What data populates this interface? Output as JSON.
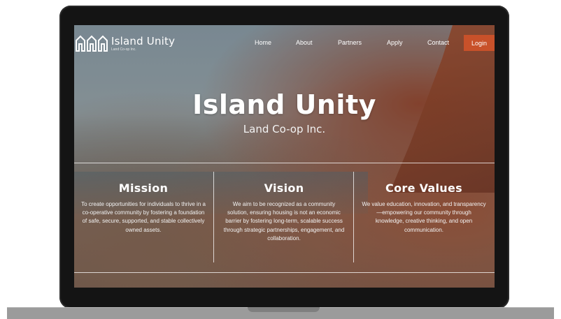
{
  "brand": {
    "name": "Island Unity",
    "subtitle": "Land Co-op Inc."
  },
  "nav": {
    "items": [
      {
        "label": "Home"
      },
      {
        "label": "About"
      },
      {
        "label": "Partners"
      },
      {
        "label": "Apply"
      },
      {
        "label": "Contact"
      }
    ],
    "login_label": "Login",
    "login_color": "#c8512a"
  },
  "hero": {
    "title": "Island Unity",
    "subtitle": "Land Co-op Inc."
  },
  "sections": [
    {
      "heading": "Mission",
      "text": "To create opportunities for individuals to thrive in a co-operative community by fostering a foundation of safe, secure, supported, and stable collectively owned assets."
    },
    {
      "heading": "Vision",
      "text": "We aim to be recognized as a community solution, ensuring housing is not an economic barrier by fostering long-term, scalable success through strategic partnerships, engagement, and collaboration."
    },
    {
      "heading": "Core Values",
      "text": "We value education, innovation, and transparency—empowering our community through knowledge, creative thinking, and open communication."
    }
  ]
}
